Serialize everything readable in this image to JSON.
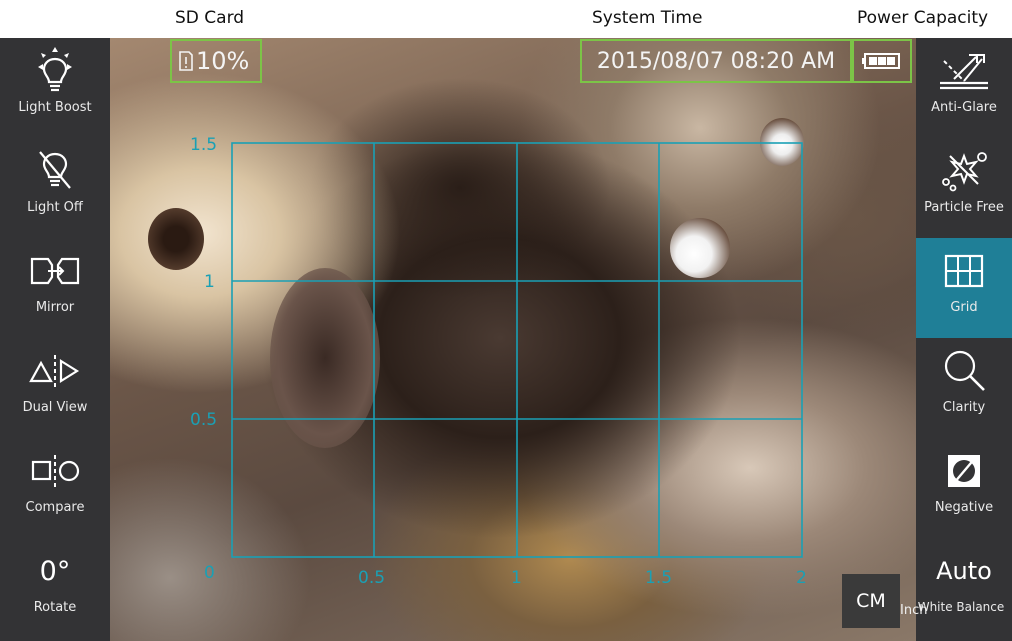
{
  "annotations": {
    "sd_card": "SD Card",
    "system_time": "System Time",
    "power_capacity": "Power Capacity"
  },
  "status": {
    "sd_card_percent": "10%",
    "datetime": "2015/08/07 08:20 AM",
    "battery_icon": "battery-full-icon",
    "highlight_color": "#7cc447"
  },
  "left_toolbar": [
    {
      "label": "Light Boost",
      "icon": "light-boost-icon"
    },
    {
      "label": "Light Off",
      "icon": "light-off-icon"
    },
    {
      "label": "Mirror",
      "icon": "mirror-icon"
    },
    {
      "label": "Dual View",
      "icon": "dual-view-icon"
    },
    {
      "label": "Compare",
      "icon": "compare-icon"
    },
    {
      "label": "Rotate",
      "value": "0°",
      "icon": "rotate-value"
    }
  ],
  "right_toolbar": [
    {
      "label": "Anti-Glare",
      "icon": "anti-glare-icon"
    },
    {
      "label": "Particle Free",
      "icon": "particle-free-icon"
    },
    {
      "label": "Grid",
      "icon": "grid-icon",
      "active": true
    },
    {
      "label": "Clarity",
      "icon": "magnifier-icon"
    },
    {
      "label": "Negative",
      "icon": "negative-icon"
    },
    {
      "label": "White Balance",
      "value": "Auto"
    }
  ],
  "grid": {
    "color": "#1aa0b5",
    "x_ticks": [
      "0",
      "0.5",
      "1",
      "1.5",
      "2"
    ],
    "y_ticks": [
      "1.5",
      "1",
      "0.5"
    ]
  },
  "units": {
    "selected": "CM",
    "alternate": "Inch"
  },
  "colors": {
    "sidebar_bg": "#333335",
    "active_bg": "#1f7f97"
  }
}
